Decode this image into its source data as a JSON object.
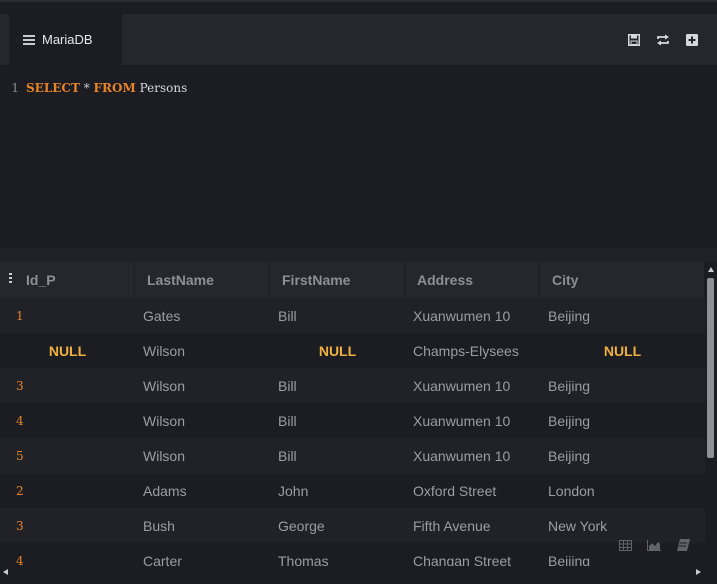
{
  "tab": {
    "label": "MariaDB",
    "icon": "database-icon"
  },
  "toolbar": {
    "icons": [
      "save-icon",
      "refresh-icon",
      "add-icon"
    ]
  },
  "editor": {
    "line_number": "1",
    "tokens": {
      "select": "SELECT",
      "star": " * ",
      "from": "FROM",
      "table": " Persons"
    }
  },
  "grid": {
    "columns": [
      "Id_P",
      "LastName",
      "FirstName",
      "Address",
      "City"
    ],
    "rows": [
      {
        "id": "1",
        "last": "Gates",
        "first": "Bill",
        "address": "Xuanwumen 10",
        "city": "Beijing"
      },
      {
        "id": "NULL",
        "last": "Wilson",
        "first": "NULL",
        "address": "Champs-Elysees",
        "city": "NULL"
      },
      {
        "id": "3",
        "last": "Wilson",
        "first": "Bill",
        "address": "Xuanwumen 10",
        "city": "Beijing"
      },
      {
        "id": "4",
        "last": "Wilson",
        "first": "Bill",
        "address": "Xuanwumen 10",
        "city": "Beijing"
      },
      {
        "id": "5",
        "last": "Wilson",
        "first": "Bill",
        "address": "Xuanwumen 10",
        "city": "Beijing"
      },
      {
        "id": "2",
        "last": "Adams",
        "first": "John",
        "address": "Oxford Street",
        "city": "London"
      },
      {
        "id": "3",
        "last": "Bush",
        "first": "George",
        "address": "Fifth Avenue",
        "city": "New York"
      },
      {
        "id": "4",
        "last": "Carter",
        "first": "Thomas",
        "address": "Changan Street",
        "city": "Beijing"
      }
    ]
  },
  "colors": {
    "keyword": "#e8832a",
    "null": "#f0b040",
    "background": "#1b1d22"
  }
}
